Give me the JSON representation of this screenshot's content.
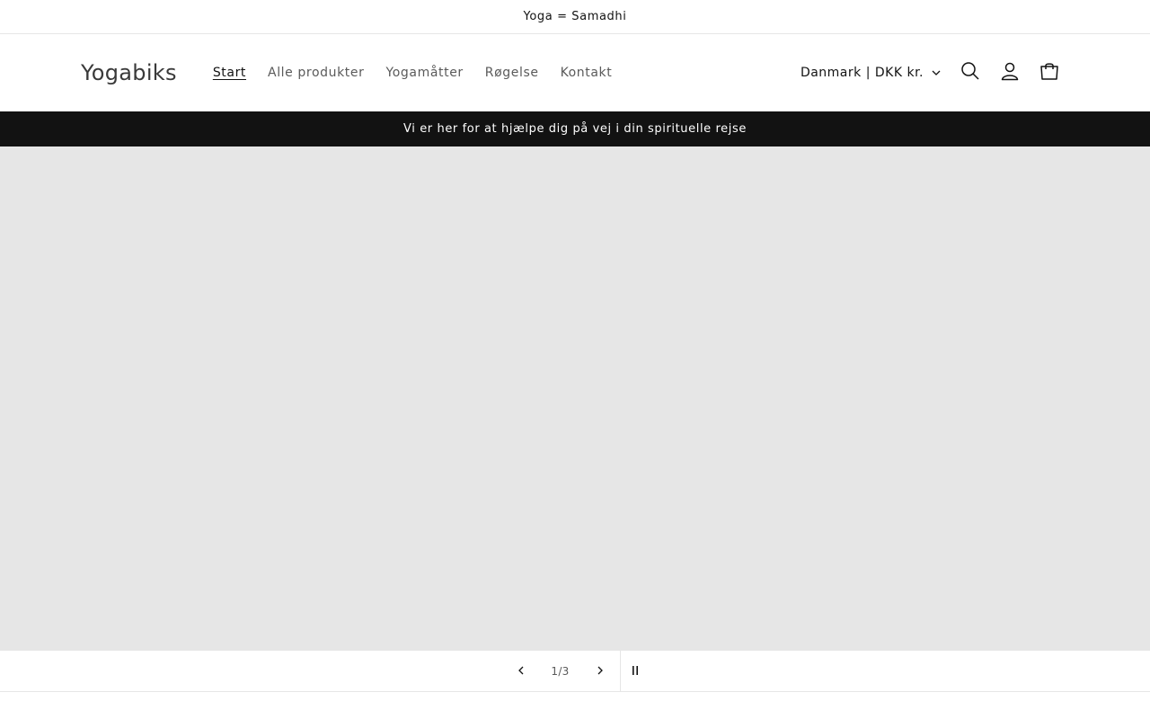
{
  "announcement": {
    "text": "Yoga = Samadhi"
  },
  "header": {
    "logo": "Yogabiks",
    "nav": [
      {
        "label": "Start",
        "active": true
      },
      {
        "label": "Alle produkter",
        "active": false
      },
      {
        "label": "Yogamåtter",
        "active": false
      },
      {
        "label": "Røgelse",
        "active": false
      },
      {
        "label": "Kontakt",
        "active": false
      }
    ],
    "country_selector": "Danmark | DKK kr.",
    "icons": [
      "search-icon",
      "account-icon",
      "cart-icon"
    ]
  },
  "info_bar": {
    "text": "Vi er her for at hjælpe dig på vej i din spirituelle rejse"
  },
  "slideshow": {
    "counter": "1/3",
    "current_slide": 1,
    "total_slides": 3,
    "background_color": "#e6e6e6"
  },
  "colors": {
    "text": "#121212",
    "muted": "#5a5a5a",
    "bar_bg": "#121212",
    "placeholder_bg": "#e6e6e6"
  }
}
